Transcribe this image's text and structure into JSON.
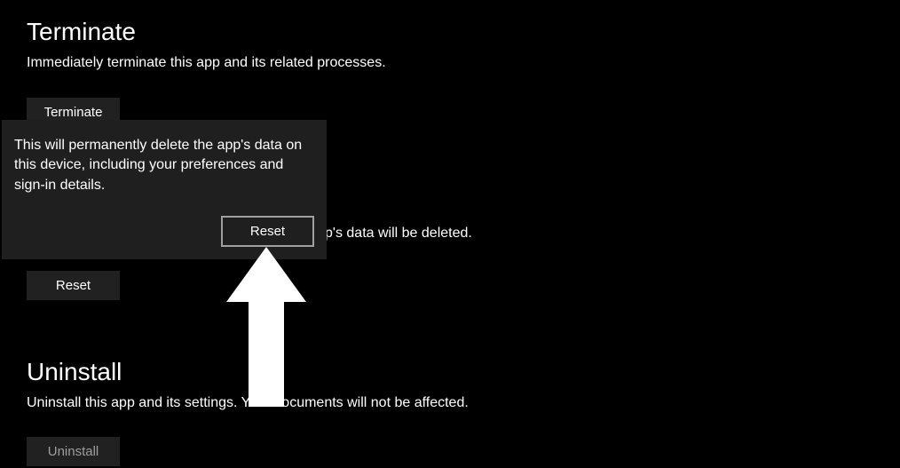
{
  "terminate": {
    "heading": "Terminate",
    "description": "Immediately terminate this app and its related processes.",
    "button": "Terminate"
  },
  "reset": {
    "partial_visible_text": "p's data will be deleted.",
    "button": "Reset"
  },
  "uninstall": {
    "heading": "Uninstall",
    "description": "Uninstall this app and its settings. Your documents will not be affected.",
    "button": "Uninstall"
  },
  "flyout": {
    "message": "This will permanently delete the app's data on this device, including your preferences and sign-in details.",
    "confirm_button": "Reset"
  },
  "annotation": {
    "arrow_target": "flyout-reset-button"
  }
}
